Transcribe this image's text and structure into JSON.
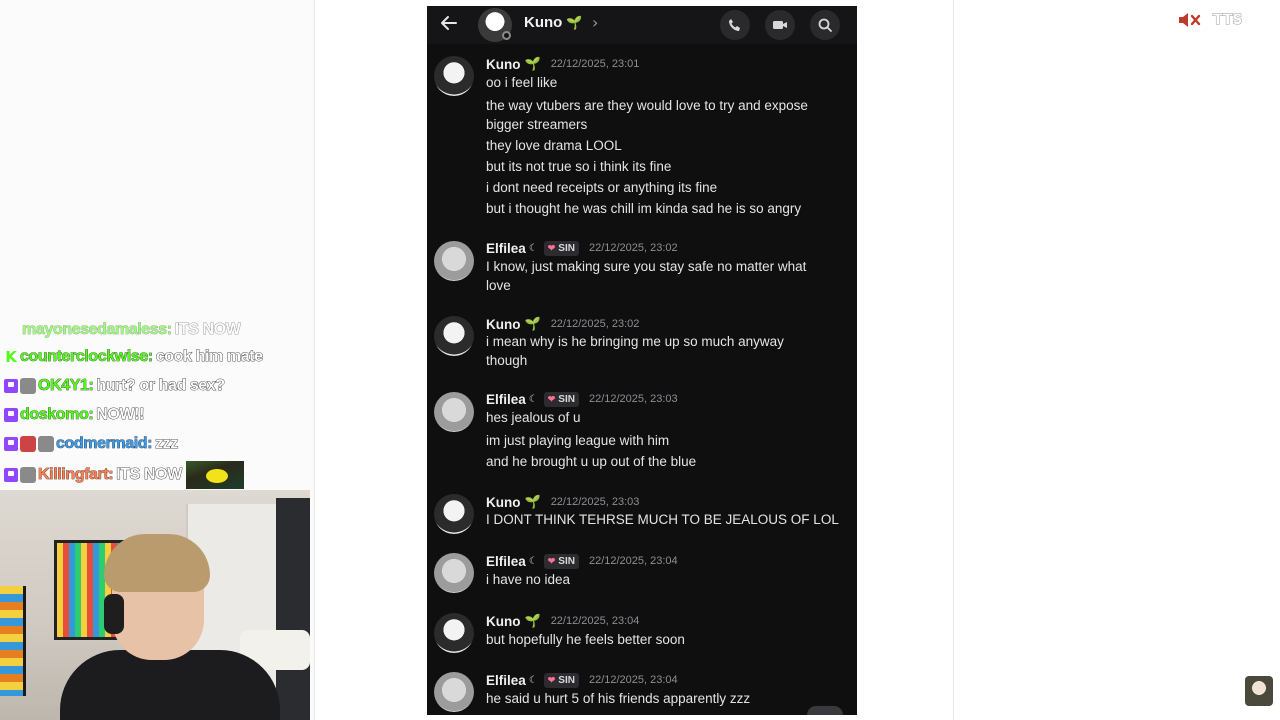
{
  "chat": {
    "lines": [
      {
        "user": "mayonesedamaless:",
        "msg": "ITS NOW",
        "user_color": "#53fc18"
      },
      {
        "user": "counterclockwise:",
        "msg": "cook him mate",
        "user_color": "#53fc18"
      },
      {
        "user": "OK4Y1:",
        "msg": "hurt? or had sex?",
        "user_color": "#53fc18"
      },
      {
        "user": "doskomo:",
        "msg": "NOW!!",
        "user_color": "#53fc18"
      },
      {
        "user": "codmermaid:",
        "msg": "zzz",
        "user_color": "#3d9be9"
      },
      {
        "user": "Killingfart:",
        "msg": "ITS NOW",
        "user_color": "#ff7f50"
      }
    ]
  },
  "phone": {
    "header": {
      "contact_name": "Kuno",
      "chevron": "›",
      "icons": [
        "phone-call-icon",
        "video-camera-icon",
        "search-icon"
      ]
    },
    "role_tag": "SIN",
    "messages": [
      {
        "user": "Kuno",
        "time": "22/12/2025, 23:01",
        "lines": [
          "oo i feel like",
          "the way vtubers are they would love to try and expose",
          "bigger streamers",
          "they love drama LOOL",
          "but its not true so i think its fine",
          "i dont need receipts or anything its fine",
          "but i thought he was chill im kinda sad he is so angry"
        ]
      },
      {
        "user": "Elfilea",
        "time": "22/12/2025, 23:02",
        "lines": [
          "I know, just making sure you stay safe no matter what",
          "love"
        ]
      },
      {
        "user": "Kuno",
        "time": "22/12/2025, 23:02",
        "lines": [
          "i mean why is he bringing me up so much anyway",
          "though"
        ]
      },
      {
        "user": "Elfilea",
        "time": "22/12/2025, 23:03",
        "lines": [
          "hes jealous of u",
          "im just playing league with him",
          "and he brought u up out of the blue"
        ]
      },
      {
        "user": "Kuno",
        "time": "22/12/2025, 23:03",
        "lines": [
          "I DONT THINK TEHRSE MUCH TO BE JEALOUS OF LOL"
        ]
      },
      {
        "user": "Elfilea",
        "time": "22/12/2025, 23:04",
        "lines": [
          "i have no idea"
        ]
      },
      {
        "user": "Kuno",
        "time": "22/12/2025, 23:04",
        "lines": [
          "but hopefully he feels better soon"
        ]
      },
      {
        "user": "Elfilea",
        "time": "22/12/2025, 23:04",
        "lines": [
          "he said u hurt 5 of his friends apparently zzz"
        ]
      }
    ]
  },
  "tts": {
    "label": "TTS",
    "icon": "speaker-muted-icon",
    "color": "#c0392b"
  }
}
